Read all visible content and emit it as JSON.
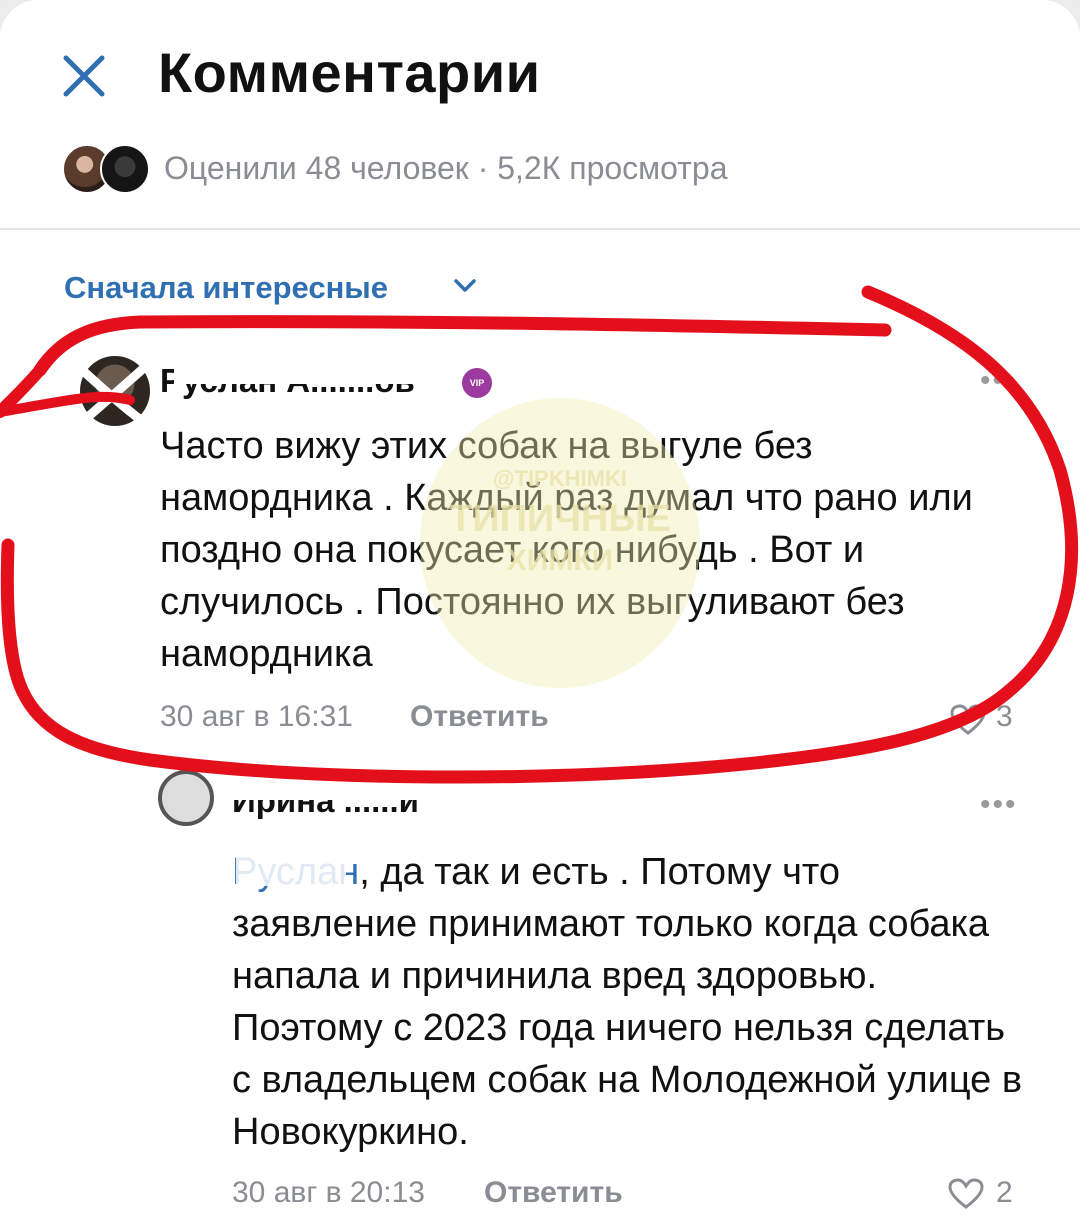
{
  "header": {
    "title": "Комментарии",
    "stats": "Оценили 48 человек · 5,2К просмотра"
  },
  "sort": {
    "label": "Сначала интересные"
  },
  "comments": [
    {
      "author": "Руслан А.......ов",
      "badge": "VIP",
      "text": "Часто вижу этих собак на выгуле без намордника . Каждый раз думал что рано или поздно она покусает кого нибудь . Вот и случилось . Постоянно их выгуливают без намордника",
      "date": "30 авг в 16:31",
      "reply_label": "Ответить",
      "likes": "3"
    },
    {
      "author": "Ирина ......й",
      "mention": "Руслан",
      "text": ", да так и есть . Потому что заявление принимают только когда собака напала и причинила вред здоровью. Поэтому с 2023 года ничего нельзя сделать с владельцем собак на Молодежной улице в Новокуркино.",
      "date": "30 авг в 20:13",
      "reply_label": "Ответить",
      "likes": "2"
    }
  ],
  "watermark": {
    "line1": "@TIPKHIMKI",
    "line2": "ТИПИЧНЫЕ",
    "line3": "ХИМКИ"
  },
  "colors": {
    "accent": "#2f6fb2",
    "annotation": "#e3101b",
    "muted": "#8a8d93"
  }
}
